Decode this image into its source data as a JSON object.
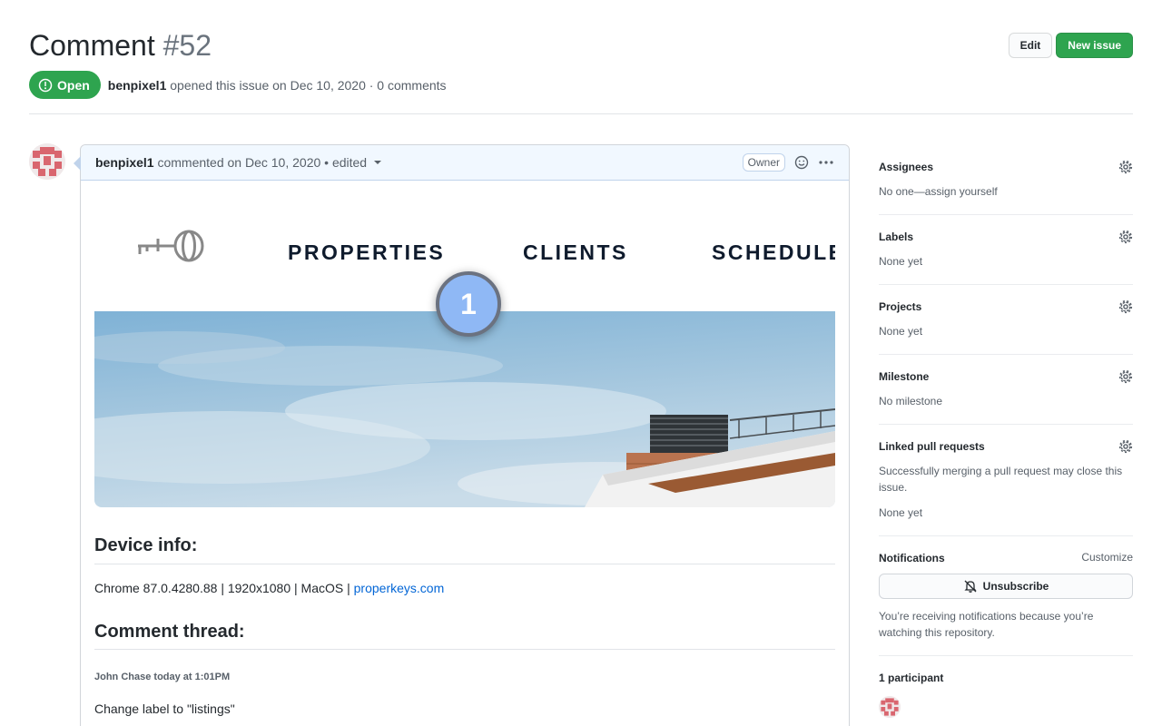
{
  "issue": {
    "title": "Comment",
    "number": "#52",
    "state": "Open",
    "author": "benpixel1",
    "opened_text": "opened this issue on Dec 10, 2020 · 0 comments"
  },
  "actions": {
    "edit_label": "Edit",
    "new_issue_label": "New issue"
  },
  "comment": {
    "author": "benpixel1",
    "meta_text": "commented on Dec 10, 2020 • edited",
    "owner_label": "Owner",
    "nav_items": [
      "PROPERTIES",
      "CLIENTS",
      "SCHEDULE"
    ],
    "marker_number": "1",
    "device_heading": "Device info:",
    "device_text": "Chrome 87.0.4280.88 | 1920x1080 | MacOS | ",
    "device_link": "properkeys.com",
    "thread_heading": "Comment thread:",
    "thread_meta": "John Chase today at 1:01PM",
    "thread_text": "Change label to \"listings\""
  },
  "sidebar": {
    "assignees": {
      "title": "Assignees",
      "body": "No one—assign yourself"
    },
    "labels": {
      "title": "Labels",
      "body": "None yet"
    },
    "projects": {
      "title": "Projects",
      "body": "None yet"
    },
    "milestone": {
      "title": "Milestone",
      "body": "No milestone"
    },
    "linked_prs": {
      "title": "Linked pull requests",
      "body": "Successfully merging a pull request may close this issue.",
      "body2": "None yet"
    },
    "notifications": {
      "title": "Notifications",
      "customize": "Customize",
      "unsubscribe": "Unsubscribe",
      "body": "You’re receiving notifications because you’re watching this repository."
    },
    "participants": {
      "title": "1 participant"
    }
  },
  "colors": {
    "green": "#2ea44f",
    "link": "#0366d6",
    "header_bg": "#f1f8ff",
    "marker": "#8fb8f5"
  }
}
